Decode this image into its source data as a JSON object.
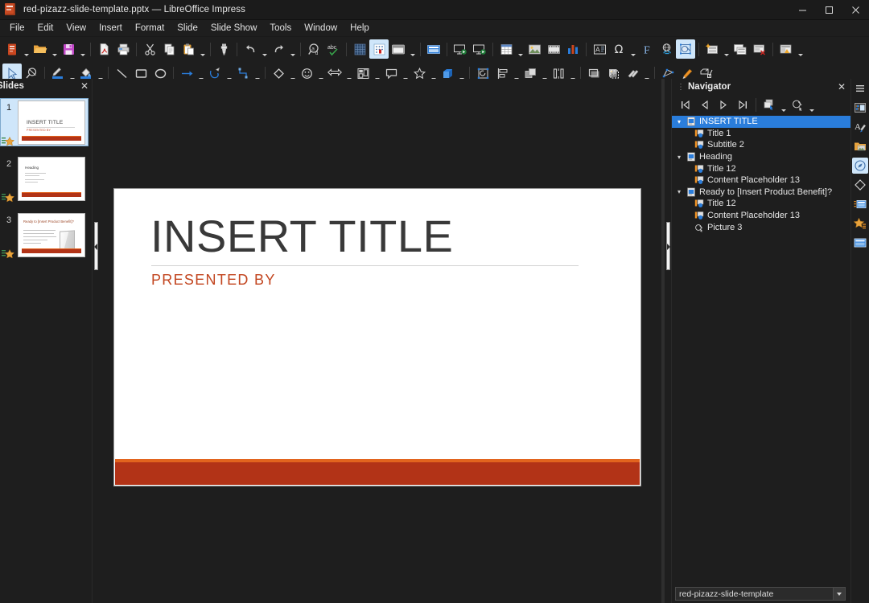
{
  "window": {
    "title": "red-pizazz-slide-template.pptx — LibreOffice Impress",
    "app_icon": "impress-document-icon",
    "controls": {
      "minimize": "—",
      "maximize": "□",
      "close": "✕"
    }
  },
  "menubar": [
    {
      "label": "File"
    },
    {
      "label": "Edit"
    },
    {
      "label": "View"
    },
    {
      "label": "Insert"
    },
    {
      "label": "Format"
    },
    {
      "label": "Slide"
    },
    {
      "label": "Slide Show"
    },
    {
      "label": "Tools"
    },
    {
      "label": "Window"
    },
    {
      "label": "Help"
    }
  ],
  "toolbar_standard": [
    {
      "name": "new-document-icon",
      "caret": true
    },
    {
      "name": "open-file-icon",
      "caret": true
    },
    {
      "name": "save-icon",
      "caret": true
    },
    {
      "sep": true
    },
    {
      "name": "export-pdf-icon"
    },
    {
      "name": "print-icon"
    },
    {
      "sep": true
    },
    {
      "name": "cut-icon"
    },
    {
      "name": "copy-icon"
    },
    {
      "name": "paste-icon",
      "caret": true
    },
    {
      "sep": true
    },
    {
      "name": "clone-formatting-icon"
    },
    {
      "sep": true
    },
    {
      "name": "undo-icon",
      "caret": true
    },
    {
      "name": "redo-icon",
      "caret": true
    },
    {
      "sep": true
    },
    {
      "name": "find-and-replace-icon"
    },
    {
      "name": "spelling-icon"
    },
    {
      "sep": true
    },
    {
      "name": "display-grid-icon"
    },
    {
      "name": "snap-to-grid-icon",
      "active": true
    },
    {
      "name": "display-views-icon",
      "caret": true
    },
    {
      "sep": true
    },
    {
      "name": "master-slide-icon"
    },
    {
      "sep": true
    },
    {
      "name": "start-from-first-slide-icon"
    },
    {
      "name": "start-from-current-slide-icon"
    },
    {
      "sep": true
    },
    {
      "name": "insert-table-icon",
      "caret": true
    },
    {
      "name": "insert-image-icon"
    },
    {
      "name": "insert-media-icon"
    },
    {
      "name": "insert-chart-icon"
    },
    {
      "sep": true
    },
    {
      "name": "insert-text-box-icon"
    },
    {
      "name": "insert-special-character-icon",
      "caret": true
    },
    {
      "name": "insert-fontwork-icon"
    },
    {
      "name": "insert-hyperlink-icon"
    },
    {
      "name": "show-draw-functions-icon",
      "active": true
    },
    {
      "sep": true
    },
    {
      "name": "new-slide-icon",
      "caret": true
    },
    {
      "name": "duplicate-slide-icon"
    },
    {
      "name": "delete-slide-icon"
    },
    {
      "sep": true
    },
    {
      "name": "slide-layout-icon",
      "caret": true
    }
  ],
  "toolbar_drawing": [
    {
      "name": "select-tool-icon",
      "active": true
    },
    {
      "name": "zoom-tool-icon"
    },
    {
      "sep": true
    },
    {
      "name": "line-color-icon",
      "caret": true
    },
    {
      "name": "fill-color-icon",
      "caret": true
    },
    {
      "sep": true
    },
    {
      "name": "insert-line-icon"
    },
    {
      "name": "rectangle-icon"
    },
    {
      "name": "ellipse-icon"
    },
    {
      "sep": true
    },
    {
      "name": "line-ends-with-arrow-icon",
      "caret": true
    },
    {
      "name": "curve-icon",
      "caret": true
    },
    {
      "name": "connector-icon",
      "caret": true
    },
    {
      "sep": true
    },
    {
      "name": "basic-shapes-icon",
      "caret": true
    },
    {
      "name": "symbol-shapes-icon",
      "caret": true
    },
    {
      "name": "block-arrows-icon",
      "caret": true
    },
    {
      "name": "flowchart-shapes-icon",
      "caret": true
    },
    {
      "name": "callout-shapes-icon",
      "caret": true
    },
    {
      "name": "stars-and-banners-icon",
      "caret": true
    },
    {
      "name": "3d-objects-icon",
      "caret": true
    },
    {
      "sep": true
    },
    {
      "name": "rotate-icon"
    },
    {
      "name": "align-objects-icon",
      "caret": true
    },
    {
      "name": "arrange-icon",
      "caret": true
    },
    {
      "name": "distribute-selection-icon",
      "caret": true
    },
    {
      "sep": true
    },
    {
      "name": "shadow-icon"
    },
    {
      "name": "crop-image-icon"
    },
    {
      "name": "image-filter-icon",
      "caret": true
    },
    {
      "sep": true
    },
    {
      "name": "points-icon"
    },
    {
      "name": "glue-points-icon"
    },
    {
      "name": "toggle-extrusion-icon"
    }
  ],
  "slides_panel": {
    "title": "Slides",
    "close_label": "✕",
    "slides": [
      {
        "number": "1",
        "selected": true,
        "title": "INSERT TITLE",
        "subtitle": "PRESENTED BY",
        "kind": "title"
      },
      {
        "number": "2",
        "selected": false,
        "title": "Heading",
        "kind": "content"
      },
      {
        "number": "3",
        "selected": false,
        "title": "Ready to [Insert Product Benefit]?",
        "kind": "picture"
      }
    ]
  },
  "slide_canvas": {
    "title": "INSERT TITLE",
    "subtitle": "PRESENTED BY",
    "colors": {
      "title": "#393939",
      "subtitle": "#c2451f",
      "band": "#b23317",
      "band_accent": "#e2641e",
      "rule": "#d2d2d2"
    }
  },
  "navigator": {
    "title": "Navigator",
    "close_label": "✕",
    "toolbar": [
      {
        "name": "first-slide-icon"
      },
      {
        "name": "previous-slide-icon"
      },
      {
        "name": "next-slide-icon"
      },
      {
        "name": "last-slide-icon"
      },
      {
        "sep": true
      },
      {
        "name": "drag-mode-icon",
        "caret": true
      },
      {
        "name": "show-shapes-icon",
        "caret": true
      }
    ],
    "tree": [
      {
        "label": "INSERT TITLE",
        "level": 0,
        "icon": "slide-icon",
        "selected": true,
        "expanded": true
      },
      {
        "label": "Title 1",
        "level": 1,
        "icon": "placeholder-icon"
      },
      {
        "label": "Subtitle 2",
        "level": 1,
        "icon": "placeholder-icon"
      },
      {
        "label": "Heading",
        "level": 0,
        "icon": "slide-icon",
        "expanded": true
      },
      {
        "label": "Title 12",
        "level": 1,
        "icon": "placeholder-icon"
      },
      {
        "label": "Content Placeholder 13",
        "level": 1,
        "icon": "placeholder-icon"
      },
      {
        "label": "Ready to [Insert Product Benefit]?",
        "level": 0,
        "icon": "slide-icon",
        "expanded": true
      },
      {
        "label": "Title 12",
        "level": 1,
        "icon": "placeholder-icon"
      },
      {
        "label": "Content Placeholder 13",
        "level": 1,
        "icon": "placeholder-icon"
      },
      {
        "label": "Picture 3",
        "level": 1,
        "icon": "shape-icon"
      }
    ],
    "document_selector": {
      "value": "red-pizazz-slide-template"
    }
  },
  "sidebar_rail": [
    {
      "name": "sidebar-settings-icon",
      "active": false
    },
    {
      "name": "properties-deck-icon",
      "active": false
    },
    {
      "name": "styles-deck-icon",
      "active": false
    },
    {
      "name": "gallery-deck-icon",
      "active": false
    },
    {
      "name": "navigator-deck-icon",
      "active": true
    },
    {
      "name": "shapes-deck-icon",
      "active": false
    },
    {
      "name": "master-slides-deck-icon",
      "active": false
    },
    {
      "name": "animation-deck-icon",
      "active": false
    },
    {
      "name": "slide-transition-deck-icon",
      "active": false
    }
  ]
}
